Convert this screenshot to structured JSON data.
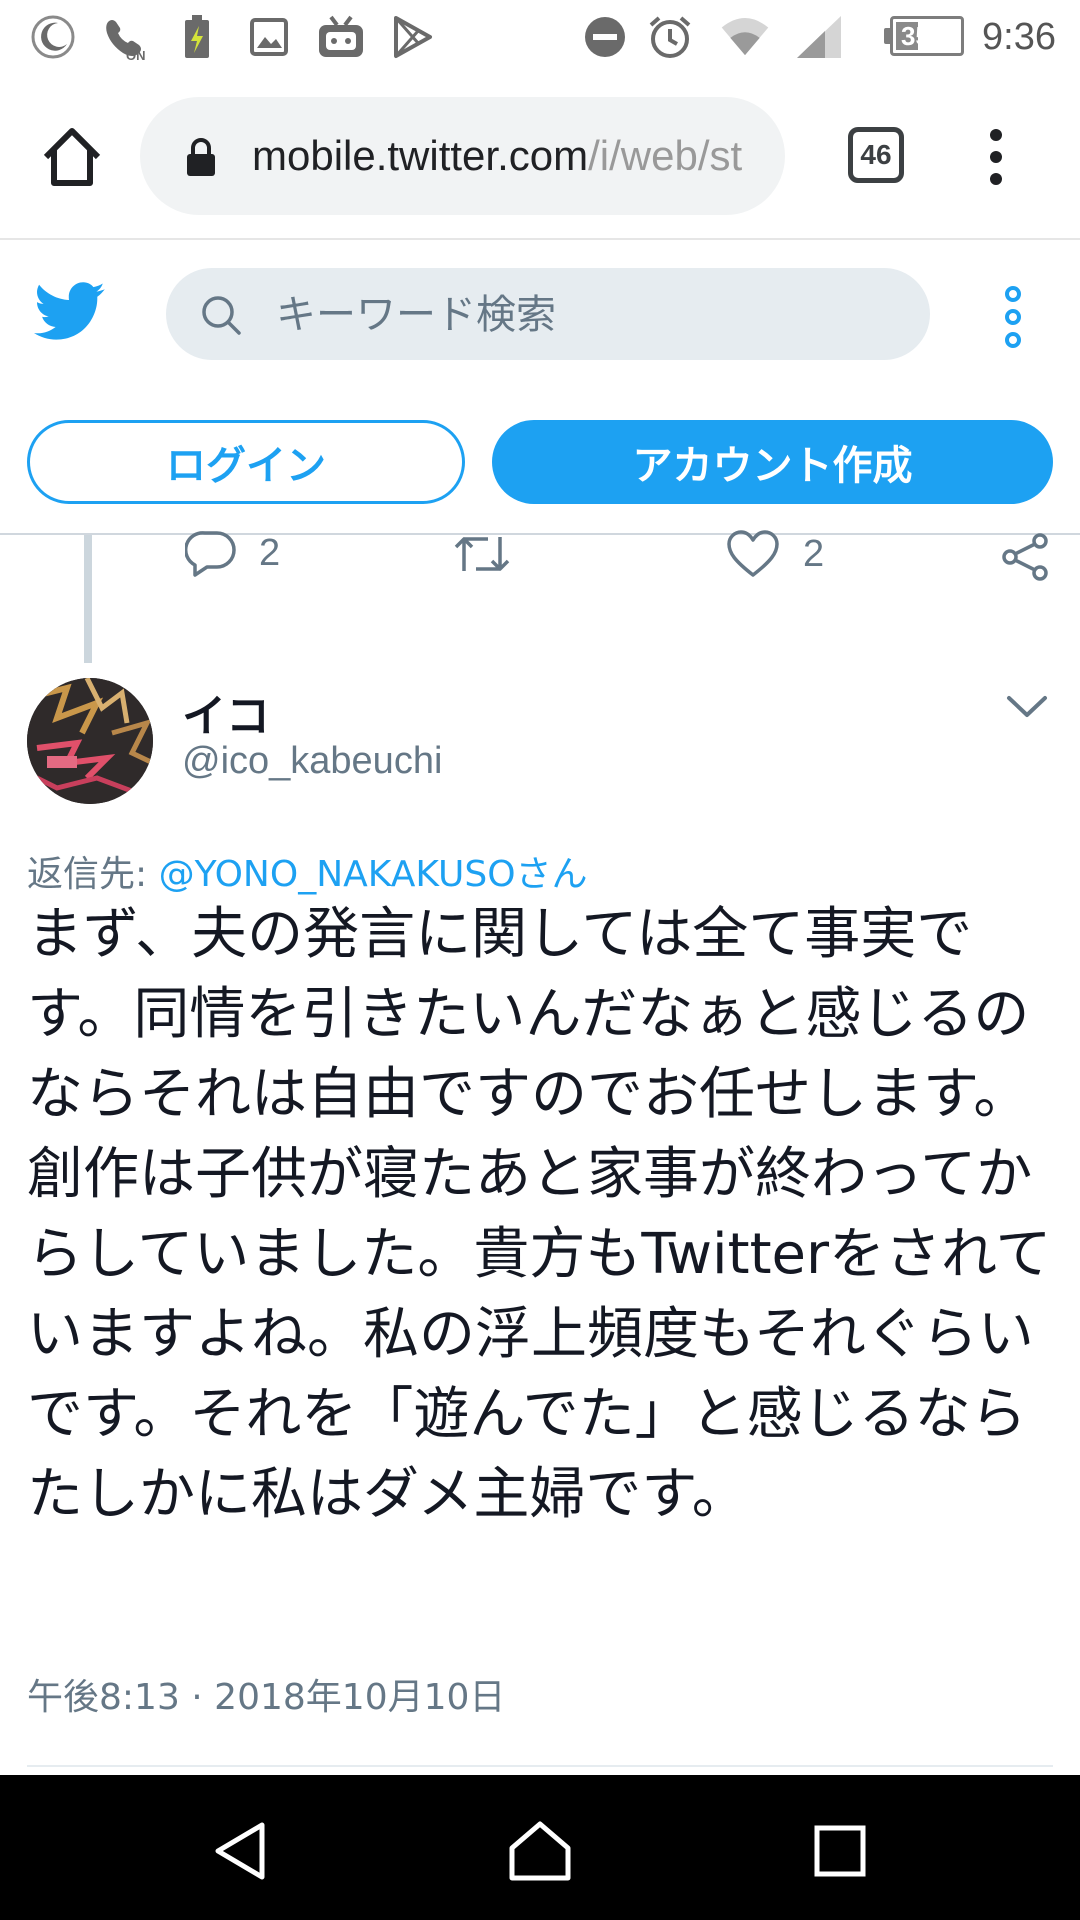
{
  "status_bar": {
    "icons": [
      "moon-icon",
      "wifi-calling-on-icon",
      "battery-saver-icon",
      "image-icon",
      "niconico-icon",
      "play-store-icon",
      "do-not-disturb-icon",
      "alarm-icon",
      "wifi-icon",
      "signal-icon"
    ],
    "wifi_calling_label": "ON",
    "battery_percent": "35%",
    "battery_level": 0.35,
    "time": "9:36"
  },
  "browser": {
    "url_host": "mobile.twitter.com",
    "url_path": "/i/web/st",
    "tab_count": "46"
  },
  "twitter_header": {
    "search_placeholder": "キーワード検索",
    "login_label": "ログイン",
    "signup_label": "アカウント作成"
  },
  "prev_tweet_actions": {
    "reply_count": "2",
    "like_count": "2"
  },
  "tweet": {
    "user_name": "イコ",
    "user_handle": "@ico_kabeuchi",
    "reply_prefix": "返信先: ",
    "reply_mention": "@YONO_NAKAKUSO",
    "reply_suffix": "さん",
    "text": "まず、夫の発言に関しては全て事実です。同情を引きたいんだなぁと感じるのならそれは自由ですのでお任せします。創作は子供が寝たあと家事が終わってからしていました。貴方もTwitterをされていますよね。私の浮上頻度もそれぐらいです。それを「遊んでた」と感じるならたしかに私はダメ主婦です。",
    "timestamp": "午後8:13 · 2018年10月10日"
  },
  "colors": {
    "twitter_blue": "#1da1f2",
    "secondary_text": "#657786",
    "primary_text": "#141823"
  }
}
